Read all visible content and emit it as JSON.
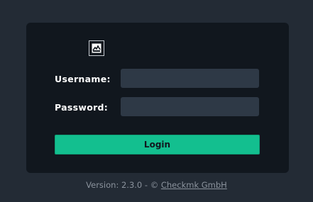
{
  "login": {
    "logo_icon": "checkmk-logo-icon",
    "username_label": "Username:",
    "username_value": "",
    "password_label": "Password:",
    "password_value": "",
    "login_button": "Login"
  },
  "footer": {
    "version_text": "Version: 2.3.0 - © ",
    "company_link": "Checkmk GmbH"
  },
  "colors": {
    "page_background": "#232b35",
    "panel_background": "#11171e",
    "input_background": "#2e3946",
    "accent": "#13bf8f"
  }
}
